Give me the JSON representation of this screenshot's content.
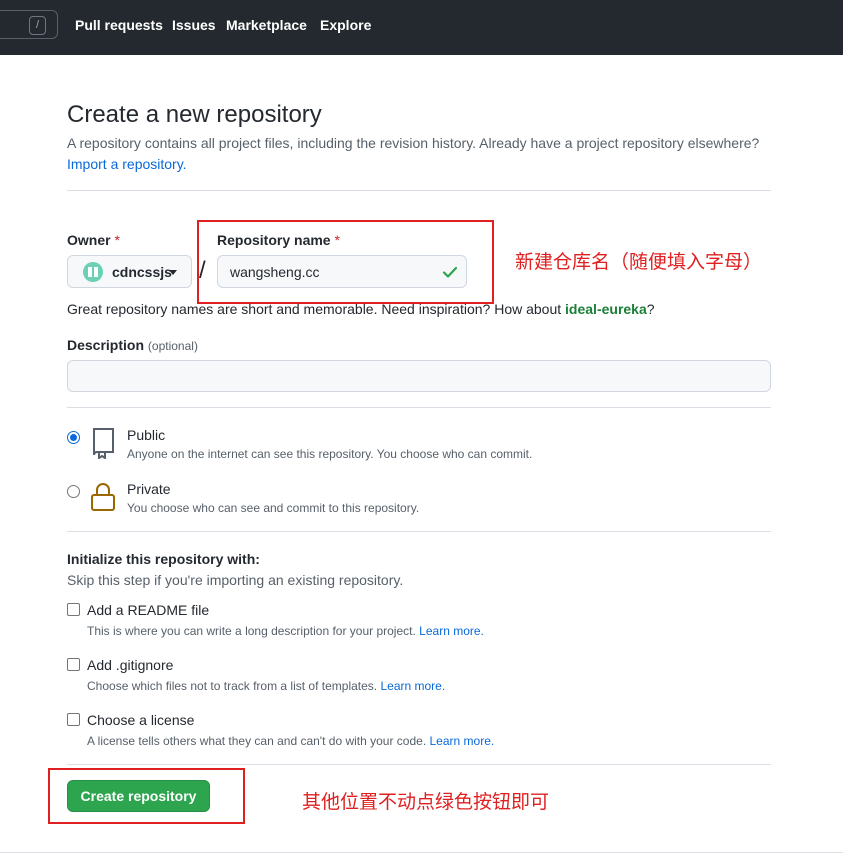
{
  "topnav": {
    "search_shortcut": "/",
    "links": [
      "Pull requests",
      "Issues",
      "Marketplace",
      "Explore"
    ]
  },
  "header": {
    "title": "Create a new repository",
    "subtitle": "A repository contains all project files, including the revision history. Already have a project repository elsewhere?",
    "import_link": "Import a repository."
  },
  "owner": {
    "label": "Owner",
    "required_mark": "*",
    "value": "cdncssjs"
  },
  "repo_name": {
    "label": "Repository name",
    "required_mark": "*",
    "value": "wangsheng.cc",
    "valid": true,
    "separator": "/"
  },
  "hint": {
    "text": "Great repository names are short and memorable. Need inspiration? How about ",
    "suggestion": "ideal-eureka",
    "end": "?"
  },
  "description": {
    "label": "Description",
    "optional": "(optional)",
    "value": ""
  },
  "visibility": {
    "selected": "public",
    "options": [
      {
        "title": "Public",
        "desc": "Anyone on the internet can see this repository. You choose who can commit.",
        "icon": "repo-icon"
      },
      {
        "title": "Private",
        "desc": "You choose who can see and commit to this repository.",
        "icon": "lock-icon"
      }
    ]
  },
  "init": {
    "title": "Initialize this repository with:",
    "subtitle": "Skip this step if you're importing an existing repository.",
    "options": [
      {
        "label": "Add a README file",
        "desc": "This is where you can write a long description for your project.",
        "link": "Learn more.",
        "checked": false
      },
      {
        "label": "Add .gitignore",
        "desc": "Choose which files not to track from a list of templates.",
        "link": "Learn more.",
        "checked": false
      },
      {
        "label": "Choose a license",
        "desc": "A license tells others what they can and can't do with your code.",
        "link": "Learn more.",
        "checked": false
      }
    ]
  },
  "create_button": "Create repository",
  "annotations": {
    "name_note": "新建仓库名（随便填入字母）",
    "button_note": "其他位置不动点绿色按钮即可"
  },
  "colors": {
    "nav_bg": "#24292f",
    "link": "#0969da",
    "primary_button": "#2da44e",
    "annotation": "#e02020"
  }
}
